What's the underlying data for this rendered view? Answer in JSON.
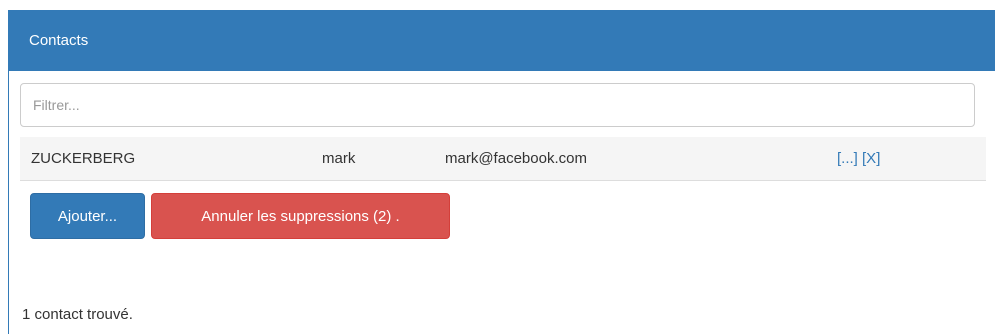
{
  "panel": {
    "title": "Contacts"
  },
  "filter": {
    "placeholder": "Filtrer...",
    "value": ""
  },
  "contacts": [
    {
      "last_name": "ZUCKERBERG",
      "first_name": "mark",
      "email": "mark@facebook.com",
      "details_label": "[...]",
      "delete_label": "[X]"
    }
  ],
  "buttons": {
    "add_label": "Ajouter...",
    "undo_label": "Annuler les suppressions (2) ."
  },
  "footer": {
    "count_text": "1 contact trouvé."
  },
  "colors": {
    "primary": "#337ab7",
    "danger": "#d9534f",
    "row_background": "#f5f5f5"
  }
}
